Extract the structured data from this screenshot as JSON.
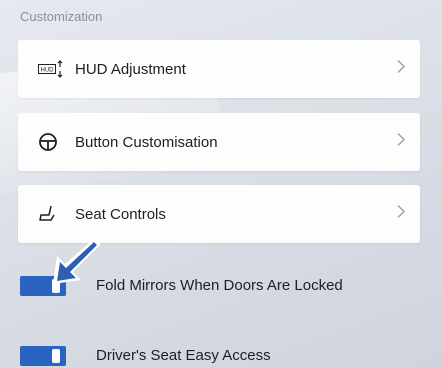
{
  "section": {
    "title": "Customization"
  },
  "menu": [
    {
      "label": "HUD Adjustment",
      "icon": "hud-icon",
      "icon_text": "HUD"
    },
    {
      "label": "Button Customisation",
      "icon": "steering-wheel-icon"
    },
    {
      "label": "Seat Controls",
      "icon": "seat-icon"
    }
  ],
  "toggles": [
    {
      "label": "Fold Mirrors When Doors Are Locked",
      "state": "on"
    },
    {
      "label": "Driver's Seat Easy Access",
      "state": "on"
    }
  ],
  "colors": {
    "accent": "#2b63c1",
    "arrow": "#2f5fb3",
    "secondary_text": "#8a8f98"
  }
}
